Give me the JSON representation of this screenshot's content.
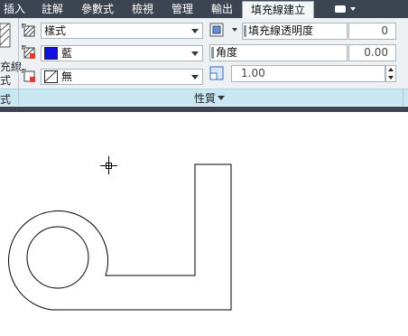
{
  "tabs": [
    {
      "label": "插入"
    },
    {
      "label": "註解"
    },
    {
      "label": "參數式"
    },
    {
      "label": "檢視"
    },
    {
      "label": "管理"
    },
    {
      "label": "輸出"
    },
    {
      "label": "填充線建立",
      "active": true
    }
  ],
  "left_panel": {
    "label_line1": "充線",
    "label_line2": "式",
    "label_line3": "式"
  },
  "properties_panel": {
    "title": "性質",
    "pattern_type": {
      "value": "樣式",
      "icon": "hatch-pattern-icon"
    },
    "hatch_color": {
      "value": "藍",
      "color": "#1010e0",
      "icon": "hatch-color-icon"
    },
    "background_color": {
      "value": "無",
      "icon": "hatch-background-icon"
    },
    "transparency": {
      "label": "填充線透明度",
      "value": "0",
      "icon": "transparency-icon"
    },
    "angle": {
      "label": "角度",
      "value": "0.00"
    },
    "scale": {
      "value": "1.00",
      "icon": "scale-icon"
    }
  },
  "colors": {
    "tabbar": "#3d4451",
    "ribbon": "#eef1f4",
    "panel_footer": "#c9e7f2",
    "drawing": "#000000"
  }
}
